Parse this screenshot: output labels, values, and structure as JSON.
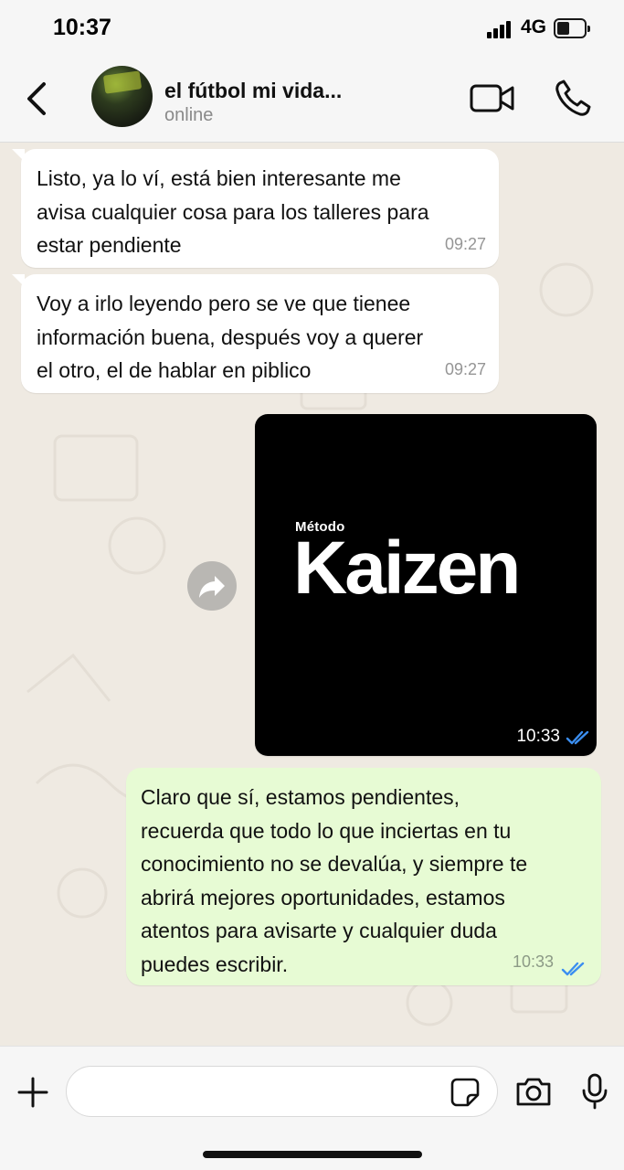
{
  "status_bar": {
    "time": "10:37",
    "network": "4G"
  },
  "header": {
    "contact_name": "el fútbol mi vida...",
    "contact_status": "online",
    "icons": {
      "back": "chevron-left-icon",
      "video": "video-camera-icon",
      "call": "phone-icon"
    }
  },
  "messages": [
    {
      "direction": "incoming",
      "text": "Listo, ya lo ví, está bien interesante me\navisa cualquier cosa para los talleres para\nestar pendiente",
      "time": "09:27"
    },
    {
      "direction": "incoming",
      "text": "Voy a irlo leyendo pero se ve que tienee\ninformación buena, después voy a querer\nel otro, el de hablar en piblico",
      "time": "09:27"
    },
    {
      "direction": "outgoing",
      "type": "image",
      "image_text_small": "Método",
      "image_text_big": "Kaizen",
      "time": "10:33",
      "status": "read"
    },
    {
      "direction": "outgoing",
      "text": "Claro que sí, estamos pendientes,\nrecuerda que todo lo que inciertas en tu\nconocimiento no se devalúa, y siempre te\nabrirá mejores oportunidades, estamos\natentos para avisarte y cualquier duda\npuedes escribir.",
      "time": "10:33",
      "status": "read"
    }
  ],
  "input_bar": {
    "placeholder": "",
    "value": ""
  },
  "colors": {
    "chat_bg": "#efeae2",
    "outgoing_bubble": "#e7fbd4",
    "incoming_bubble": "#ffffff",
    "read_ticks": "#3b8ef0"
  }
}
